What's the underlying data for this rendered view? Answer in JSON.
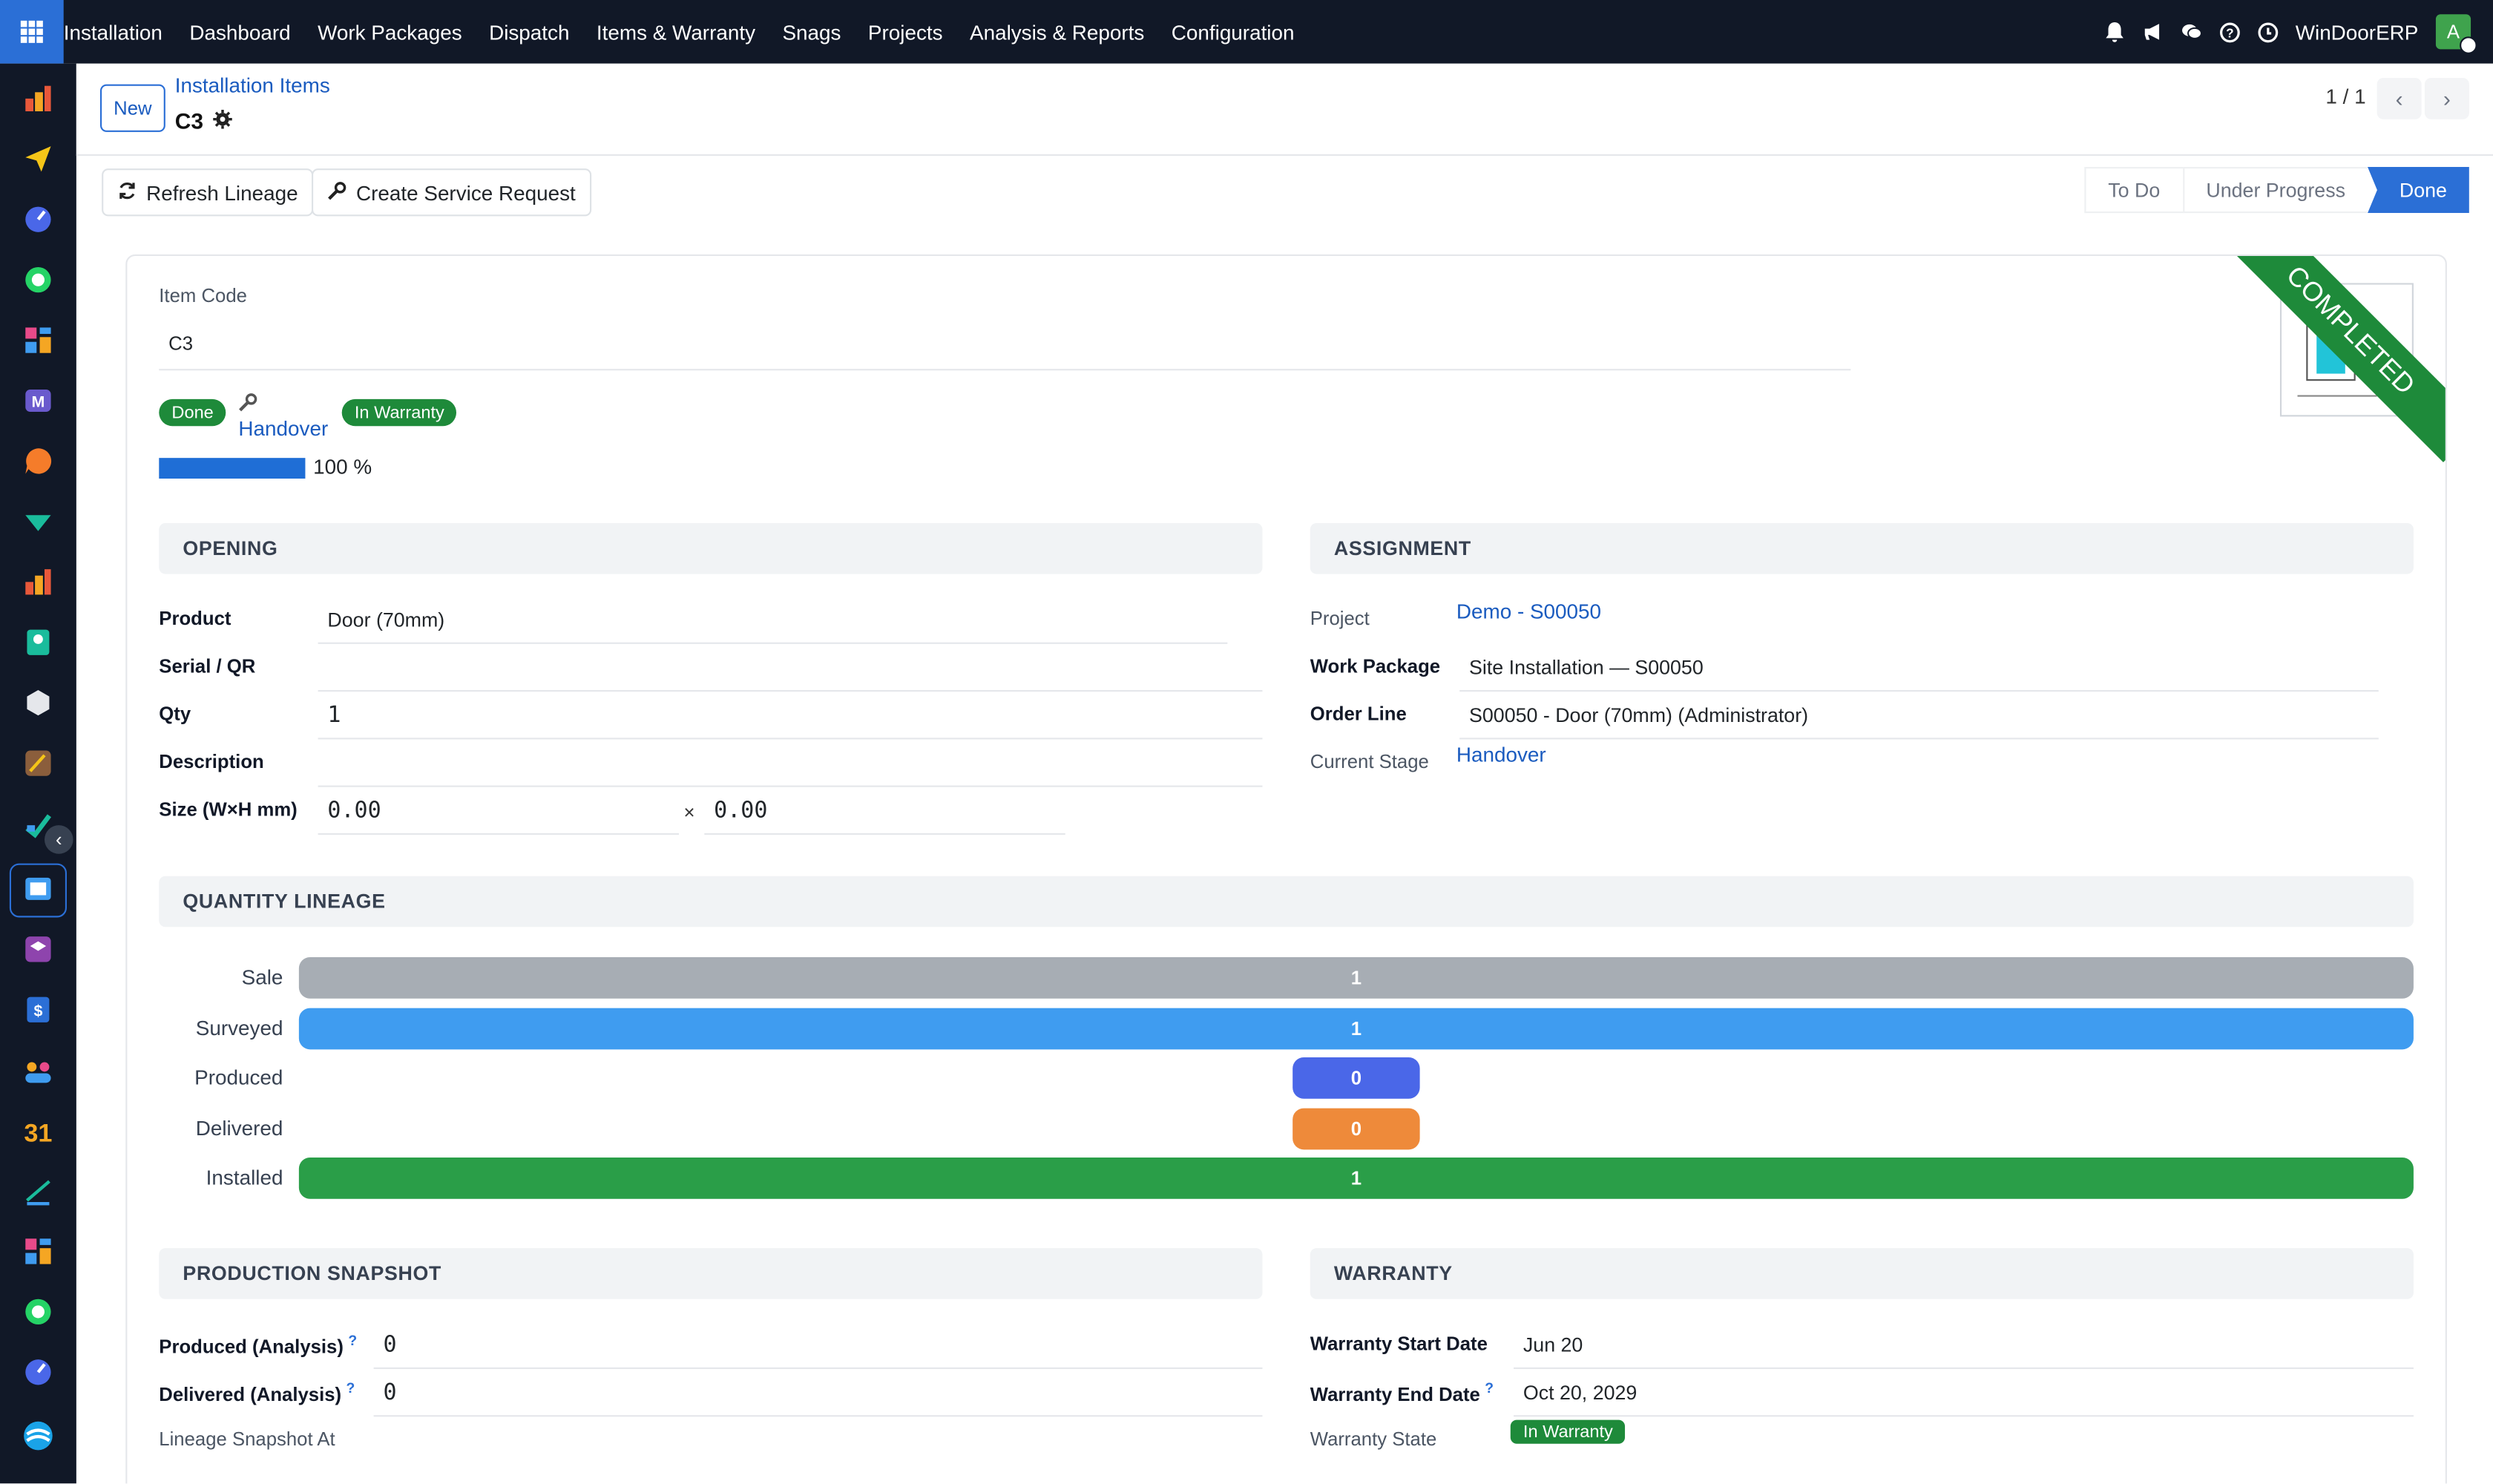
{
  "topbar": {
    "menu": [
      "Installation",
      "Dashboard",
      "Work Packages",
      "Dispatch",
      "Items & Warranty",
      "Snags",
      "Projects",
      "Analysis & Reports",
      "Configuration"
    ],
    "company": "WinDoorERP",
    "avatar_letter": "A"
  },
  "control_panel": {
    "new_label": "New",
    "breadcrumb": "Installation Items",
    "record_title": "C3",
    "pager": "1 / 1"
  },
  "actions": {
    "refresh_label": "Refresh Lineage",
    "service_label": "Create Service Request"
  },
  "statusbar": {
    "stages": [
      "To Do",
      "Under Progress",
      "Done"
    ],
    "active": "Done"
  },
  "sheet": {
    "ribbon": "COMPLETED",
    "item_code_label": "Item Code",
    "item_code": "C3",
    "state_badge": "Done",
    "stage_link": "Handover",
    "warranty_badge": "In Warranty",
    "progress_text": "100 %",
    "progress_value": 1.0,
    "opening": {
      "title": "OPENING",
      "product_label": "Product",
      "product": "Door (70mm)",
      "serial_label": "Serial / QR",
      "serial": "",
      "qty_label": "Qty",
      "qty": "1",
      "desc_label": "Description",
      "desc": "",
      "size_label": "Size (W×H mm)",
      "width": "0.00",
      "times": "×",
      "height": "0.00"
    },
    "assignment": {
      "title": "ASSIGNMENT",
      "project_label": "Project",
      "project": "Demo - S00050",
      "wp_label": "Work Package",
      "wp": "Site Installation — S00050",
      "order_label": "Order Line",
      "order": "S00050 - Door (70mm) (Administrator)",
      "stage_label": "Current Stage",
      "stage": "Handover"
    },
    "lineage": {
      "title": "QUANTITY LINEAGE",
      "rows": [
        {
          "label": "Sale",
          "value": "1",
          "color": "#a7adb4"
        },
        {
          "label": "Surveyed",
          "value": "1",
          "color": "#3f9cf0"
        },
        {
          "label": "Produced",
          "value": "0",
          "color": "#4a67e8"
        },
        {
          "label": "Delivered",
          "value": "0",
          "color": "#ee8a3a"
        },
        {
          "label": "Installed",
          "value": "1",
          "color": "#2a9e48"
        }
      ]
    },
    "production": {
      "title": "PRODUCTION SNAPSHOT",
      "produced_label": "Produced (Analysis)",
      "produced": "0",
      "delivered_label": "Delivered (Analysis)",
      "delivered": "0",
      "snapshot_label": "Lineage Snapshot At",
      "snapshot": ""
    },
    "warranty": {
      "title": "WARRANTY",
      "start_label": "Warranty Start Date",
      "start": "Jun 20",
      "end_label": "Warranty End Date",
      "end": "Oct 20, 2029",
      "state_label": "Warranty State",
      "state": "In Warranty"
    }
  }
}
